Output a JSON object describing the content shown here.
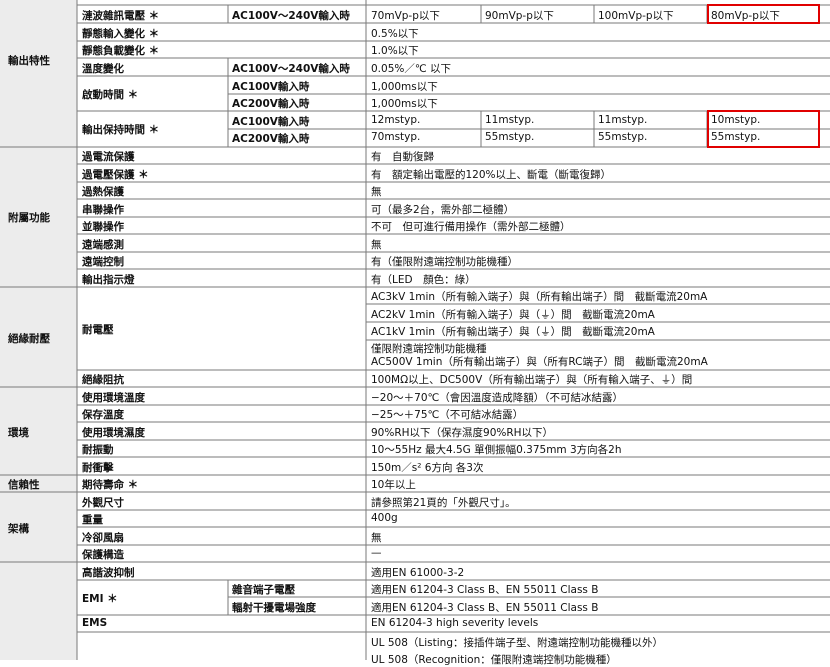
{
  "categories": {
    "output": "輸出特性",
    "aux": "附屬功能",
    "insulation": "絕緣耐壓",
    "env": "環境",
    "reliability": "信賴性",
    "structure": "架構"
  },
  "output_rows": {
    "ripple": {
      "label": "漣波雜訊電壓 ＊",
      "condition": "AC100V〜240V輸入時",
      "values": [
        "70mVp-p以下",
        "90mVp-p以下",
        "100mVp-p以下",
        "80mVp-p以下"
      ]
    },
    "static_input": {
      "label": "靜態輸入變化 ＊",
      "value": "0.5%以下"
    },
    "static_load": {
      "label": "靜態負載變化 ＊",
      "value": "1.0%以下"
    },
    "temp": {
      "label": "溫度變化",
      "condition": "AC100V〜240V輸入時",
      "value": "0.05%／℃ 以下"
    },
    "startup": {
      "label": "啟動時間 ＊",
      "cond1": "AC100V輸入時",
      "val1": "1,000ms以下",
      "cond2": "AC200V輸入時",
      "val2": "1,000ms以下"
    },
    "holdup": {
      "label": "輸出保持時間 ＊",
      "cond1": "AC100V輸入時",
      "vals1": [
        "12mstyp.",
        "11mstyp.",
        "11mstyp.",
        "10mstyp."
      ],
      "cond2": "AC200V輸入時",
      "vals2": [
        "70mstyp.",
        "55mstyp.",
        "55mstyp.",
        "55mstyp."
      ]
    }
  },
  "aux_rows": [
    {
      "label": "過電流保護",
      "value": "有　自動復歸"
    },
    {
      "label": "過電壓保護 ＊",
      "value": "有　額定輸出電壓的120%以上、斷電（斷電復歸）"
    },
    {
      "label": "過熱保護",
      "value": "無"
    },
    {
      "label": "串聯操作",
      "value": "可（最多2台，需外部二極體）"
    },
    {
      "label": "並聯操作",
      "value": "不可　但可進行備用操作（需外部二極體）"
    },
    {
      "label": "遠端感測",
      "value": "無"
    },
    {
      "label": "遠端控制",
      "value": "有（僅限附遠端控制功能機種）"
    },
    {
      "label": "輸出指示燈",
      "value": "有（LED　顏色：綠）"
    }
  ],
  "insulation_rows": {
    "withstand_label": "耐電壓",
    "withstand_values": [
      "AC3kV 1min（所有輸入端子）與（所有輸出端子）間　截斷電流20mA",
      "AC2kV 1min（所有輸入端子）與（⏚）間　截斷電流20mA",
      "AC1kV 1min（所有輸出端子）與（⏚）間　截斷電流20mA"
    ],
    "withstand_remote_1": "僅限附遠端控制功能機種",
    "withstand_remote_2": "AC500V 1min（所有輸出端子）與（所有RC端子）間　截斷電流20mA",
    "resistance_label": "絕緣阻抗",
    "resistance_value": "100MΩ以上、DC500V（所有輸出端子）與（所有輸入端子、⏚）間"
  },
  "env_rows": [
    {
      "label": "使用環境溫度",
      "value": "−20〜＋70℃（會因溫度造成降額）（不可結冰結露）"
    },
    {
      "label": "保存溫度",
      "value": "−25〜＋75℃（不可結冰結露）"
    },
    {
      "label": "使用環境濕度",
      "value": "90%RH以下（保存濕度90%RH以下）"
    },
    {
      "label": "耐振動",
      "value": "10〜55Hz 最大4.5G 單側振幅0.375mm 3方向各2h"
    },
    {
      "label": "耐衝擊",
      "value": "150m／s² 6方向 各3次"
    }
  ],
  "reliability_row": {
    "label": "期待壽命 ＊",
    "value": "10年以上"
  },
  "structure_rows": [
    {
      "label": "外觀尺寸",
      "value": "請參照第21頁的「外觀尺寸」。"
    },
    {
      "label": "重量",
      "value": "400g"
    },
    {
      "label": "冷卻風扇",
      "value": "無"
    },
    {
      "label": "保護構造",
      "value": "—"
    }
  ],
  "standards_rows": {
    "harmonic_label": "高諧波抑制",
    "harmonic_value": "適用EN 61000-3-2",
    "emi_label": "EMI ＊",
    "emi_noise_label": "雜音端子電壓",
    "emi_noise_value": "適用EN 61204-3 Class B、EN 55011 Class B",
    "emi_radiated_label": "輻射干擾電場強度",
    "emi_radiated_value": "適用EN 61204-3 Class B、EN 55011 Class B",
    "ems_label": "EMS",
    "ems_value": "EN 61204-3 high severity levels",
    "ul_1": "UL 508（Listing：接插件端子型、附遠端控制功能機種以外）",
    "ul_2": "UL 508（Recognition：僅限附遠端控制功能機種）"
  }
}
